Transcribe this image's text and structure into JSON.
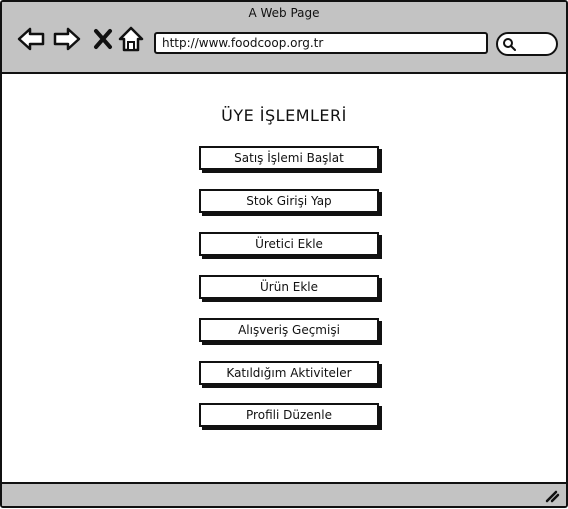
{
  "window": {
    "title": "A Web Page"
  },
  "toolbar": {
    "url": "http://www.foodcoop.org.tr"
  },
  "page": {
    "heading": "ÜYE İŞLEMLERİ",
    "buttons": [
      "Satış İşlemi Başlat",
      "Stok Girişi Yap",
      "Üretici Ekle",
      "Ürün Ekle",
      "Alışveriş Geçmişi",
      "Katıldığım Aktiviteler",
      "Profili Düzenle"
    ]
  },
  "icons": [
    "back-arrow-icon",
    "forward-arrow-icon",
    "close-icon",
    "home-icon",
    "search-icon",
    "resize-grip-icon"
  ]
}
